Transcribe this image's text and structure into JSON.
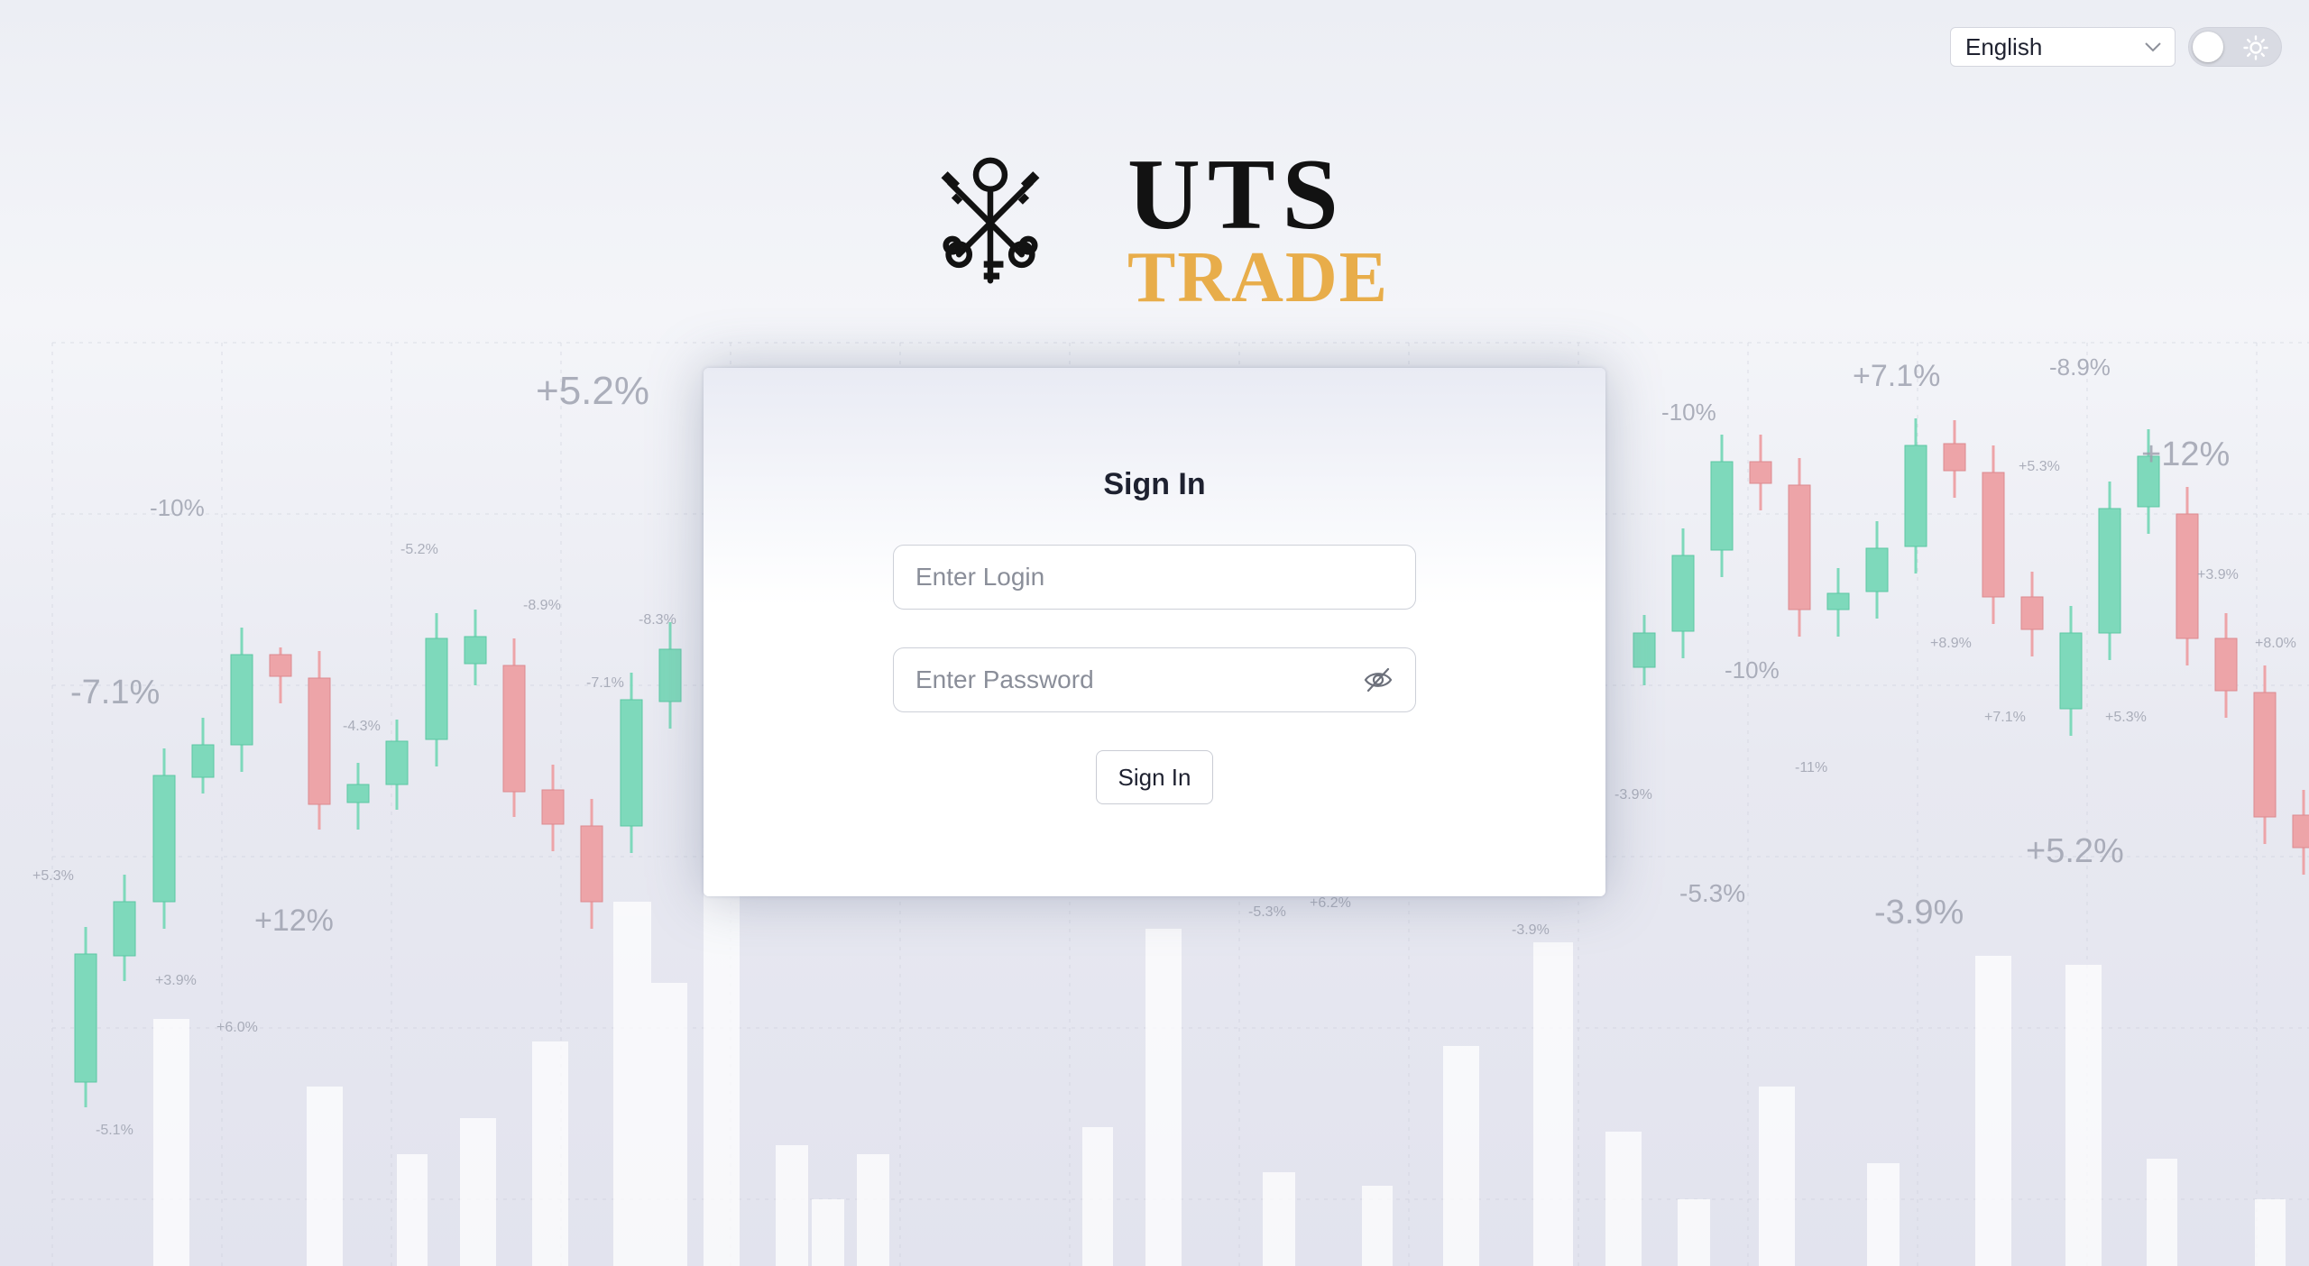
{
  "app": {
    "brand_line1": "UTS",
    "brand_line2": "TRADE"
  },
  "topbar": {
    "language_selected": "English",
    "theme_mode": "light"
  },
  "signin": {
    "title": "Sign In",
    "login_placeholder": "Enter Login",
    "password_placeholder": "Enter Password",
    "submit_label": "Sign In"
  },
  "background_labels": [
    "+5.2%",
    "-10%",
    "-7.1%",
    "+12%",
    "-5.2%",
    "-8.9%",
    "-8.3%",
    "-4.3%",
    "-7.1%",
    "+3.9%",
    "+6.0%",
    "-5.1%",
    "+5.3%",
    "-10%",
    "+7.1%",
    "-8.9%",
    "+12%",
    "+5.3%",
    "+3.9%",
    "+8.9%",
    "-10%",
    "+8.0%",
    "+7.1%",
    "+5.3%",
    "-11%",
    "-3.9%",
    "+5.2%",
    "-5.3%",
    "-3.9%",
    "-5.3%",
    "+6.2%",
    "-3.9%"
  ],
  "colors": {
    "accent_gold": "#e8ad4a",
    "candle_up": "#7ed9bb",
    "candle_down": "#eda4a8",
    "brand_dark": "#121212"
  },
  "icons": {
    "language_chevron": "chevron-down-icon",
    "theme": "sun-icon",
    "password_visibility": "eye-off-icon",
    "logo": "crossed-keys-icon"
  }
}
